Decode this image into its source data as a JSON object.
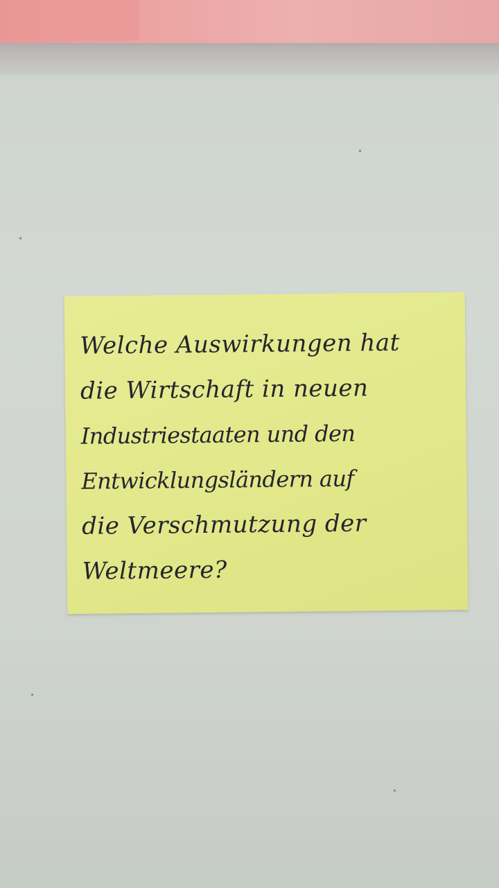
{
  "note": {
    "lines": [
      "Welche Auswirkungen hat",
      "die Wirtschaft in neuen",
      "Industriestaaten und den",
      "Entwicklungsländern auf",
      "die Verschmutzung der",
      "Weltmeere?"
    ]
  },
  "colors": {
    "wall": "#d3d8d2",
    "note": "#e4e98d",
    "ink": "#25252b",
    "top_strip": "#eba4a2"
  }
}
